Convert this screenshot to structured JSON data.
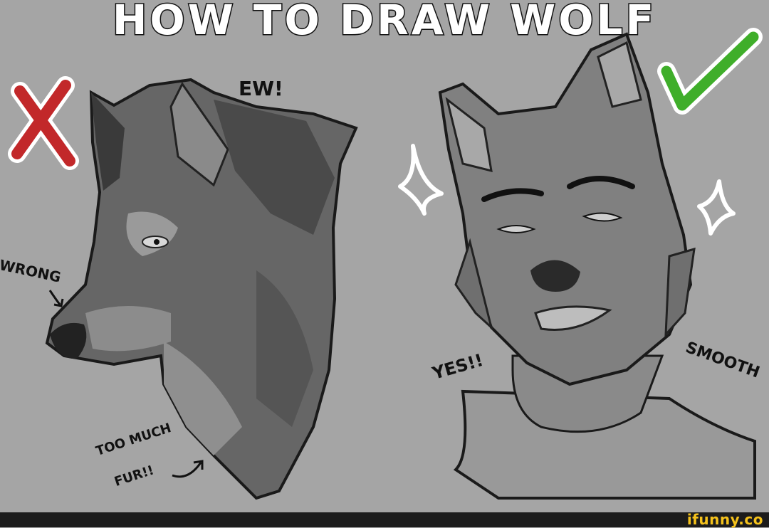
{
  "title": "HOW TO DRAW WOLF",
  "annotations": {
    "ew": "EW!",
    "wrong": "WRONG",
    "too_much": "TOO MUCH",
    "fur": "FUR!!",
    "yes": "YES!!",
    "smooth": "SMOOTH"
  },
  "footer": {
    "brand": "ifunny.co"
  },
  "colors": {
    "background": "#a5a5a5",
    "cross": "#c2282a",
    "check": "#3fae2a",
    "brand": "#f5c21b"
  }
}
